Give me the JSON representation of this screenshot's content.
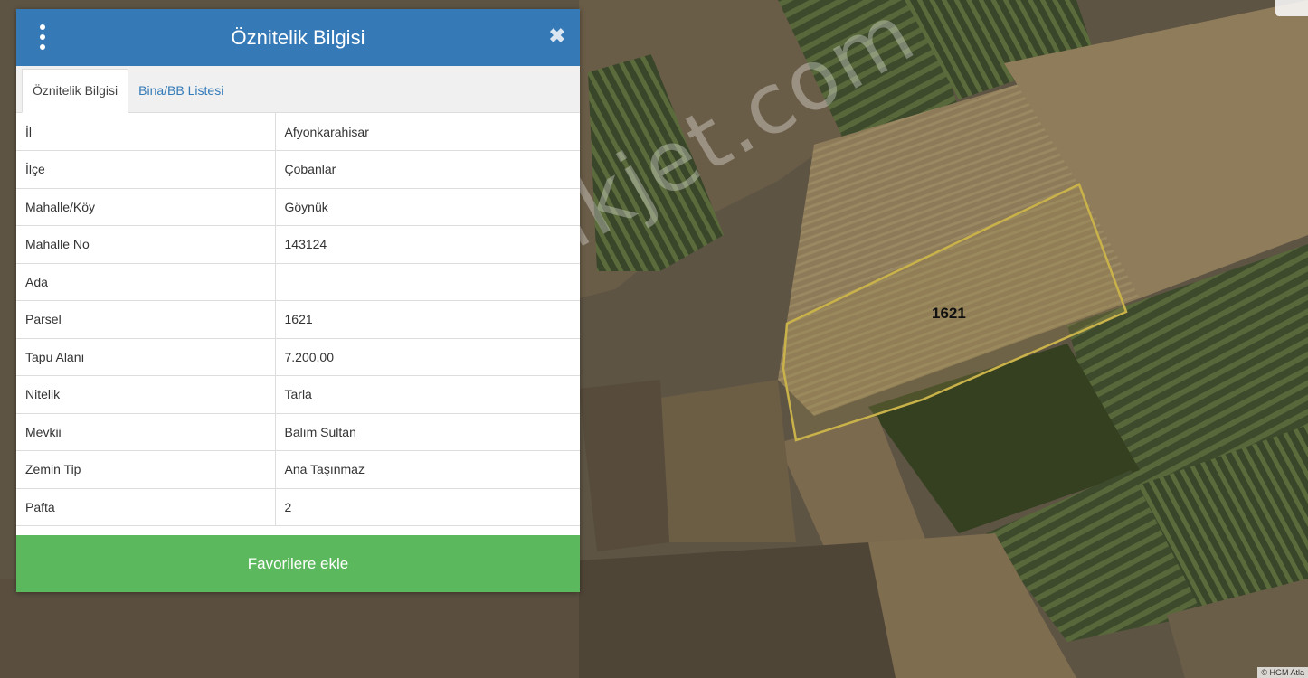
{
  "panel": {
    "title": "Öznitelik Bilgisi",
    "close_symbol": "✖",
    "tabs": [
      {
        "label": "Öznitelik Bilgisi",
        "active": true
      },
      {
        "label": "Bina/BB Listesi",
        "active": false
      }
    ],
    "rows": [
      {
        "key": "İl",
        "value": "Afyonkarahisar"
      },
      {
        "key": "İlçe",
        "value": "Çobanlar"
      },
      {
        "key": "Mahalle/Köy",
        "value": "Göynük"
      },
      {
        "key": "Mahalle No",
        "value": "143124"
      },
      {
        "key": "Ada",
        "value": ""
      },
      {
        "key": "Parsel",
        "value": "1621"
      },
      {
        "key": "Tapu Alanı",
        "value": "7.200,00"
      },
      {
        "key": "Nitelik",
        "value": "Tarla"
      },
      {
        "key": "Mevkii",
        "value": "Balım Sultan"
      },
      {
        "key": "Zemin Tip",
        "value": "Ana Taşınmaz"
      },
      {
        "key": "Pafta",
        "value": "2"
      }
    ],
    "favorite_button": "Favorilere ekle"
  },
  "map": {
    "parcel_label": "1621",
    "watermark": "emlakjet.com",
    "attribution": "© HGM Atla",
    "parcel_outline_color": "#c9b24a"
  },
  "colors": {
    "header": "#3579b7",
    "favorite": "#5cb85c",
    "tab_link": "#337ab7"
  }
}
